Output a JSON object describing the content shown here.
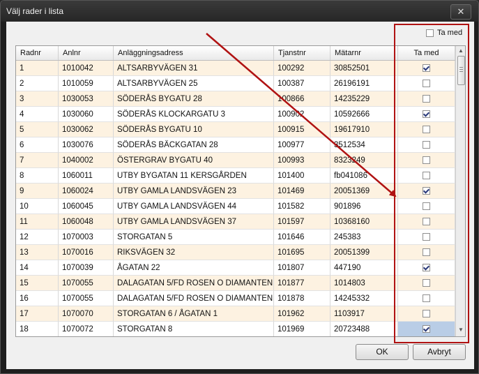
{
  "window": {
    "title": "Välj rader i lista",
    "close_glyph": "✕"
  },
  "top_checkbox": {
    "label": "Ta med",
    "checked": false
  },
  "columns": [
    "Radnr",
    "Anlnr",
    "Anläggningsadress",
    "Tjanstnr",
    "Mätarnr",
    "Ta med"
  ],
  "rows": [
    {
      "radnr": "1",
      "anlnr": "1010042",
      "adress": "ALTSARBYVÄGEN 31",
      "tjanstnr": "100292",
      "matarnr": "30852501",
      "tamed": true
    },
    {
      "radnr": "2",
      "anlnr": "1010059",
      "adress": "ALTSARBYVÄGEN 25",
      "tjanstnr": "100387",
      "matarnr": "26196191",
      "tamed": false
    },
    {
      "radnr": "3",
      "anlnr": "1030053",
      "adress": "SÖDERÅS BYGATU 28",
      "tjanstnr": "100866",
      "matarnr": "14235229",
      "tamed": false
    },
    {
      "radnr": "4",
      "anlnr": "1030060",
      "adress": "SÖDERÅS KLOCKARGATU 3",
      "tjanstnr": "100902",
      "matarnr": "10592666",
      "tamed": true
    },
    {
      "radnr": "5",
      "anlnr": "1030062",
      "adress": "SÖDERÅS BYGATU 10",
      "tjanstnr": "100915",
      "matarnr": "19617910",
      "tamed": false
    },
    {
      "radnr": "6",
      "anlnr": "1030076",
      "adress": "SÖDERÅS BÄCKGATAN 28",
      "tjanstnr": "100977",
      "matarnr": "3512534",
      "tamed": false
    },
    {
      "radnr": "7",
      "anlnr": "1040002",
      "adress": "ÖSTERGRAV BYGATU 40",
      "tjanstnr": "100993",
      "matarnr": "8323249",
      "tamed": false
    },
    {
      "radnr": "8",
      "anlnr": "1060011",
      "adress": "UTBY BYGATAN 11 KERSGÅRDEN",
      "tjanstnr": "101400",
      "matarnr": "fb041086",
      "tamed": false
    },
    {
      "radnr": "9",
      "anlnr": "1060024",
      "adress": "UTBY GAMLA LANDSVÄGEN 23",
      "tjanstnr": "101469",
      "matarnr": "20051369",
      "tamed": true
    },
    {
      "radnr": "10",
      "anlnr": "1060045",
      "adress": "UTBY GAMLA LANDSVÄGEN 44",
      "tjanstnr": "101582",
      "matarnr": "901896",
      "tamed": false
    },
    {
      "radnr": "11",
      "anlnr": "1060048",
      "adress": "UTBY GAMLA LANDSVÄGEN 37",
      "tjanstnr": "101597",
      "matarnr": "10368160",
      "tamed": false
    },
    {
      "radnr": "12",
      "anlnr": "1070003",
      "adress": "STORGATAN 5",
      "tjanstnr": "101646",
      "matarnr": "245383",
      "tamed": false
    },
    {
      "radnr": "13",
      "anlnr": "1070016",
      "adress": "RIKSVÄGEN 32",
      "tjanstnr": "101695",
      "matarnr": "20051399",
      "tamed": false
    },
    {
      "radnr": "14",
      "anlnr": "1070039",
      "adress": "ÅGATAN 22",
      "tjanstnr": "101807",
      "matarnr": "447190",
      "tamed": true
    },
    {
      "radnr": "15",
      "anlnr": "1070055",
      "adress": "DALAGATAN   5/FD ROSEN O DIAMANTEN",
      "tjanstnr": "101877",
      "matarnr": "1014803",
      "tamed": false
    },
    {
      "radnr": "16",
      "anlnr": "1070055",
      "adress": "DALAGATAN   5/FD ROSEN O DIAMANTEN",
      "tjanstnr": "101878",
      "matarnr": "14245332",
      "tamed": false
    },
    {
      "radnr": "17",
      "anlnr": "1070070",
      "adress": "STORGATAN 6 / ÅGATAN 1",
      "tjanstnr": "101962",
      "matarnr": "1103917",
      "tamed": false
    },
    {
      "radnr": "18",
      "anlnr": "1070072",
      "adress": "STORGATAN 8",
      "tjanstnr": "101969",
      "matarnr": "20723488",
      "tamed": true
    }
  ],
  "selected_row": "18",
  "buttons": {
    "ok": "OK",
    "cancel": "Avbryt"
  },
  "colors": {
    "alt_row": "#fdf2e1",
    "annotation": "#b01212",
    "selected_cell": "#b9cde6"
  }
}
